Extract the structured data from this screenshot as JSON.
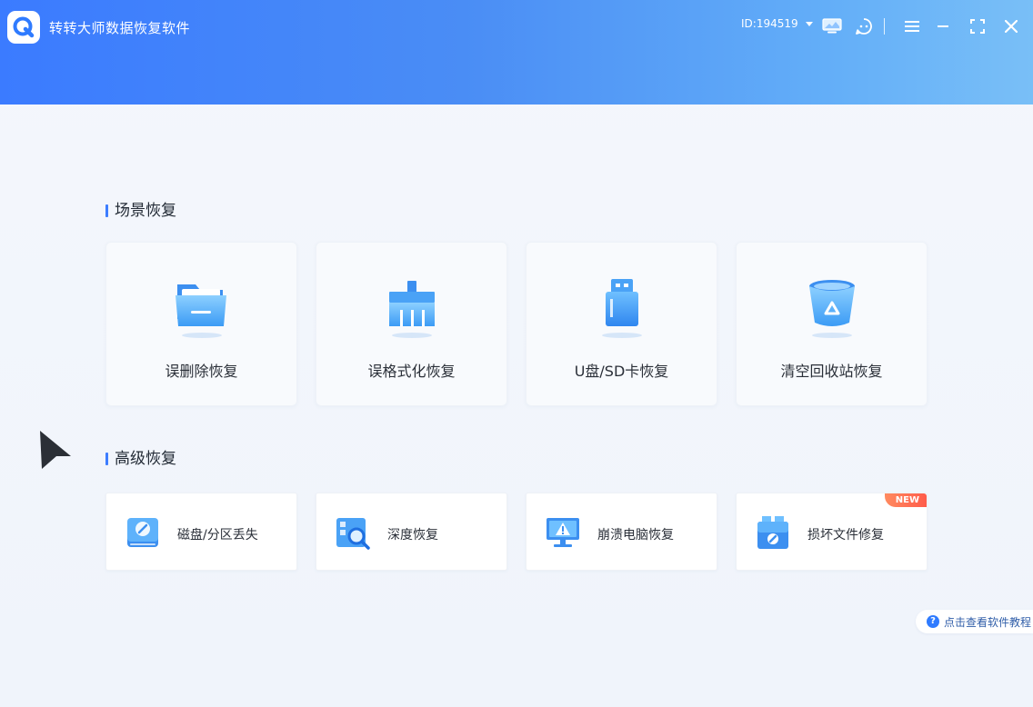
{
  "app": {
    "title": "转转大师数据恢复软件"
  },
  "header": {
    "user_id": "ID:194519",
    "icons": [
      "monitor-icon",
      "support-icon",
      "menu-icon",
      "minimize-icon",
      "maximize-icon",
      "close-icon"
    ]
  },
  "scene_recovery": {
    "title": "场景恢复",
    "items": [
      {
        "label": "误删除恢复",
        "icon": "folder-icon"
      },
      {
        "label": "误格式化恢复",
        "icon": "broom-icon"
      },
      {
        "label": "U盘/SD卡恢复",
        "icon": "usb-drive-icon"
      },
      {
        "label": "清空回收站恢复",
        "icon": "recycle-bin-icon"
      }
    ]
  },
  "advanced_recovery": {
    "title": "高级恢复",
    "items": [
      {
        "label": "磁盘/分区丢失",
        "icon": "disk-icon"
      },
      {
        "label": "深度恢复",
        "icon": "deep-scan-icon"
      },
      {
        "label": "崩溃电脑恢复",
        "icon": "crashed-computer-icon"
      },
      {
        "label": "损坏文件修复",
        "icon": "file-repair-icon",
        "badge": "NEW"
      }
    ]
  },
  "help": {
    "label": "点击查看软件教程"
  },
  "colors": {
    "accent": "#3d7dff",
    "header_start": "#3b7bff",
    "header_end": "#79bff7",
    "badge": "#ff6b4f"
  }
}
